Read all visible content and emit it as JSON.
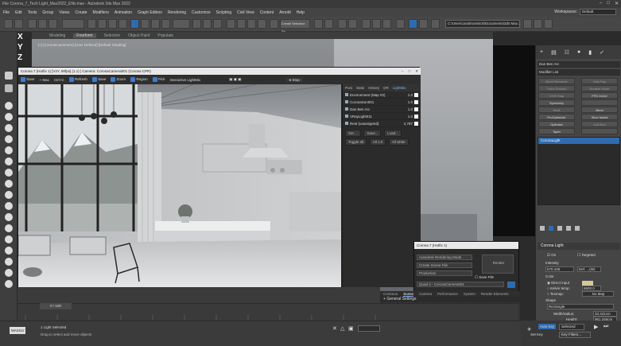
{
  "titlebar": {
    "title": "File Corona_7_Tech Light_Max2022_ENv.max - Autodesk 3ds Max 2022"
  },
  "menu": [
    "File",
    "Edit",
    "Tools",
    "Group",
    "Views",
    "Create",
    "Modifiers",
    "Animation",
    "Graph Editors",
    "Rendering",
    "Customize",
    "Scripting",
    "Civil View",
    "Content",
    "Arnold",
    "Help"
  ],
  "workspaces": {
    "label": "Workspaces:",
    "value": "Default"
  },
  "toolbar": {
    "selection_set": "Create Selection Se",
    "project_path": "C:\\Users\\Justin\\cetnick\\Documents\\3ds Max 2022"
  },
  "ribbon": {
    "tabs": [
      "Modeling",
      "Freeform",
      "Selection",
      "Object Paint",
      "Populate"
    ]
  },
  "axes": [
    "X",
    "Y",
    "Z"
  ],
  "viewport": {
    "label": "[+] [CoronaCamera01] [User Defined] [Default Shading]"
  },
  "framebuffer": {
    "title": "Corona 7 (Hotfix 1) [V2Y, 80fps] (1.1) | Camera: CoronaCamera001 (Corona CPR)",
    "tools": [
      "Save",
      "+ Max",
      "Ctrl+C",
      "Refresh",
      "Save",
      "Zoom",
      "Region",
      "Pick",
      "Interactive LightMix"
    ],
    "stop": "Stop",
    "tabs": [
      "Post",
      "Stats",
      "History",
      "DR",
      "LightMix"
    ],
    "layers": [
      {
        "name": "Environment (Map #2)",
        "value": "1.0"
      },
      {
        "name": "CoronaSun001",
        "value": "1.0"
      },
      {
        "name": "Dan Ben Arc",
        "value": "1.0"
      },
      {
        "name": "VRayLight011",
        "value": "1.0"
      },
      {
        "name": "Rest (unassigned)",
        "value": "2,787"
      }
    ],
    "buttons": [
      "Set ...",
      "Save...",
      "Load...",
      "Toggle all",
      "All 1.0",
      "All white"
    ]
  },
  "cmdpanel": {
    "object_name": "Dan Ben Arc",
    "modifier_list": "Modifier List",
    "mod_buttons": [
      "Mesh Renderer",
      "Edit Poly",
      "Turbo Smooth",
      "Surface Mode",
      "UVW Map",
      "FFD 2x2x2",
      "Symmetry",
      "",
      "Shell",
      "Bend",
      "ProOptimizer",
      "Slice Island",
      "Optimize",
      "Unit Box",
      "Taper",
      ""
    ],
    "stack_item": "CoronaLight",
    "rollout": "Corona Light",
    "on_label": "On",
    "targeted_label": "Targeted",
    "intensity_label": "Intensity",
    "intensity_value": "570.436",
    "intensity_unit": "Def. ...(W)",
    "color_label": "Color",
    "color_opts": [
      "Direct input",
      "Kelvin temp:",
      "Texmap:"
    ],
    "kelvin": "6500.0",
    "texmap": "No Map",
    "shape_label": "Shape",
    "shape_value": "Rectangle",
    "width_label": "Width/radius:",
    "width_value": "33.341cm",
    "height_label": "Height:",
    "height_value": "961.346cm",
    "segments_label": "Segments:",
    "segments_value": "",
    "directional_label": "Directionality:",
    "directional_value": "0.0",
    "visible_label": "Emit on both sides",
    "viewport_label": "Viewport"
  },
  "cvfb": {
    "title": "Corona 7 (Hotfix 1)",
    "mode": "Autodesk Rendering Mode",
    "preset": "Create Scene File",
    "production": "Production",
    "render": "Render",
    "save_file": "Save File",
    "view": "Quad 4 - CoronaCamera001"
  },
  "corpanel": {
    "tabs": [
      "Common",
      "Scene",
      "Camera",
      "Performance",
      "System",
      "Render Elements"
    ],
    "section": "General Settings",
    "buttons": [
      "Show VFB",
      "Start interactive",
      "Lock prefs",
      "Open Material Library",
      "Export settings"
    ],
    "progressive": "Progressive Rendering Limits",
    "pass_limit_label": "Pass limit:",
    "pass_limit": "0",
    "time_limit_label": "Time limit:",
    "time_limit": "0",
    "noise_label": "Noise level limit:",
    "noise_value": "0.0"
  },
  "timeline": {
    "frame": "0 / 100"
  },
  "status": {
    "selected": "1 Light Selected",
    "prompt": "Drag to select and move objects",
    "maxscript": "MAXScr",
    "auto_key": "Auto Key",
    "selected_dropdown": "Selected",
    "set_key": "Set Key",
    "key_filters": "Key Filters..."
  },
  "colors": {
    "accent": "#2f6bb0",
    "panel": "#454545",
    "bg": "#2b2b2b"
  }
}
